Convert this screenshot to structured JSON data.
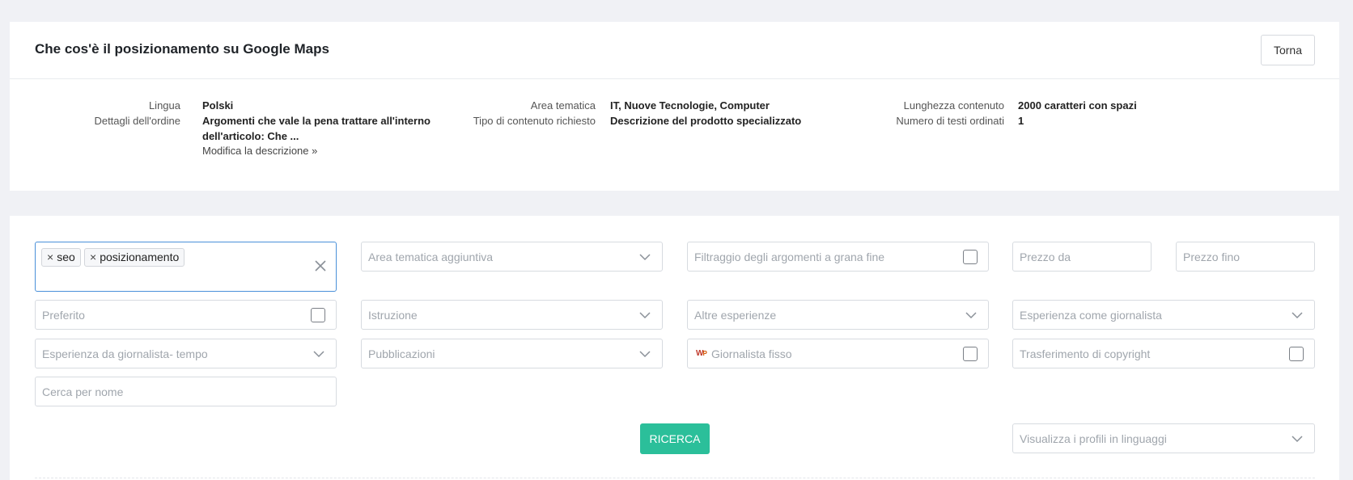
{
  "header": {
    "title": "Che cos'è il posizionamento su Google Maps",
    "back_label": "Torna"
  },
  "order_info": {
    "language_label": "Lingua",
    "language_value": "Polski",
    "details_label": "Dettagli dell'ordine",
    "details_line1": "Argomenti che vale la pena trattare all'interno",
    "details_line2": "dell'articolo: Che ...",
    "edit_link": "Modifica la descrizione »",
    "topic_label": "Area tematica",
    "topic_value": "IT, Nuove Tecnologie, Computer",
    "content_type_label": "Tipo di contenuto richiesto",
    "content_type_value": "Descrizione del prodotto specializzato",
    "length_label": "Lunghezza contenuto",
    "length_value": "2000 caratteri con spazi",
    "count_label": "Numero di testi ordinati",
    "count_value": "1"
  },
  "filters": {
    "tags": [
      "seo",
      "posizionamento"
    ],
    "tag_remove_glyph": "×",
    "additional_area": "Area tematica aggiuntiva",
    "fine_topics": "Filtraggio degli argomenti a grana fine",
    "price_from": "Prezzo da",
    "price_to": "Prezzo fino",
    "favorite": "Preferito",
    "education": "Istruzione",
    "other_experience": "Altre esperienze",
    "journalist_experience": "Esperienza come giornalista",
    "journalist_time": "Esperienza da giornalista- tempo",
    "publications": "Pubblicazioni",
    "fixed_journalist": "Giornalista fisso",
    "fixed_journalist_logo": "W",
    "fixed_journalist_logo_sup": "P",
    "copyright": "Trasferimento di copyright",
    "search_name": "Cerca per nome",
    "search_button": "RICERCA",
    "profile_languages": "Visualizza i profili in linguaggi"
  },
  "colors": {
    "accent": "#2bbf9a",
    "focus_border": "#4a90d9",
    "background": "#f0f1f5"
  },
  "icons": {
    "dropdown": "chevron-down-icon",
    "clear": "close-icon",
    "tag_remove": "close-icon"
  }
}
